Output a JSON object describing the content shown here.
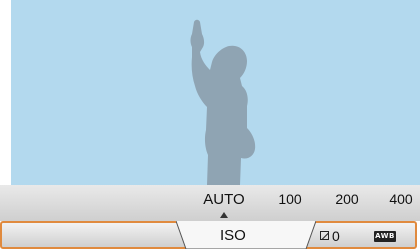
{
  "scene": {
    "subject": "silhouette"
  },
  "value_strip": {
    "items": [
      {
        "label": "AUTO",
        "selected": true
      },
      {
        "label": "100",
        "selected": false
      },
      {
        "label": "200",
        "selected": false
      },
      {
        "label": "400",
        "selected": false
      }
    ]
  },
  "menu": {
    "active_tab": "ISO",
    "exposure_value": "0",
    "white_balance_icon_text": "AWB"
  },
  "colors": {
    "sky": "#b3d9ee",
    "silhouette": "#8fa4b3",
    "accent_border": "#e08a3e"
  }
}
